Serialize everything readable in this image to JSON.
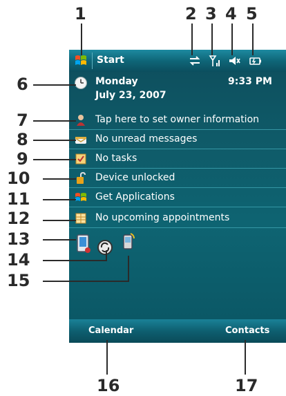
{
  "callouts": [
    "1",
    "2",
    "3",
    "4",
    "5",
    "6",
    "7",
    "8",
    "9",
    "10",
    "11",
    "12",
    "13",
    "14",
    "15",
    "16",
    "17"
  ],
  "titlebar": {
    "title": "Start"
  },
  "today": {
    "day": "Monday",
    "date": "July 23, 2007",
    "time": "9:33 PM"
  },
  "items": [
    {
      "label": "Tap here to set owner information",
      "icon": "owner-icon"
    },
    {
      "label": "No unread messages",
      "icon": "messages-icon"
    },
    {
      "label": "No tasks",
      "icon": "tasks-icon"
    },
    {
      "label": "Device unlocked",
      "icon": "lock-icon"
    },
    {
      "label": "Get Applications",
      "icon": "windows-flag-icon"
    },
    {
      "label": "No upcoming appointments",
      "icon": "calendar-icon"
    }
  ],
  "softkeys": {
    "left": "Calendar",
    "right": "Contacts"
  },
  "colors": {
    "screen_bg": "#0e5a68",
    "accent": "#1d8aa0",
    "text": "#ffffff"
  }
}
